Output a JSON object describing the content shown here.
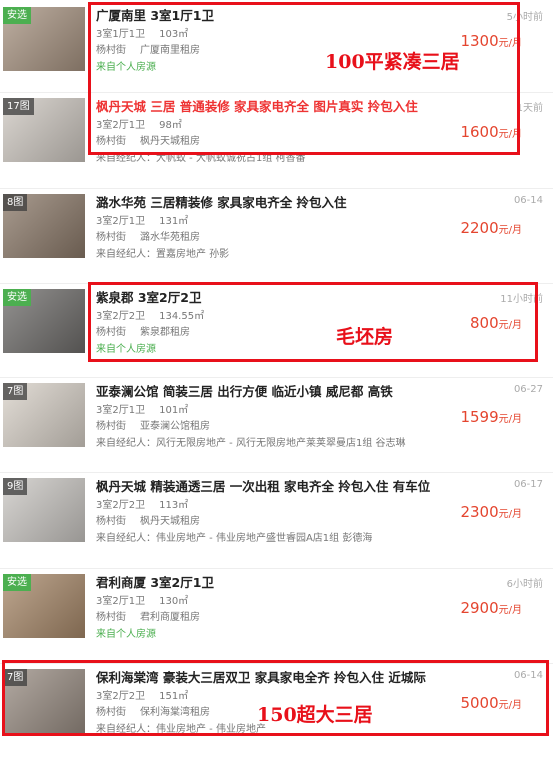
{
  "listings": [
    {
      "badge": "安选",
      "badge_type": "green",
      "title": "广厦南里 3室1厅1卫",
      "title_red": false,
      "layout": "3室1厅1卫",
      "area": "103㎡",
      "location": "杨村街",
      "estate_link": "广厦南里租房",
      "source": "来自个人房源",
      "source_type": "personal",
      "time": "5小时前",
      "price": "1300",
      "unit": "元/月",
      "thumb": "#a89482"
    },
    {
      "badge": "17图",
      "badge_type": "gray",
      "title": "枫丹天城 三居 普通装修 家具家电齐全 图片真实 拎包入住",
      "title_red": true,
      "layout": "3室2厅1卫",
      "area": "98㎡",
      "location": "杨村街",
      "estate_link": "枫丹天城租房",
      "source": "来自经纪人：大帆蚁 - 大帆蚁诚祝占1组 柯香番",
      "source_type": "agent",
      "time": "1天前",
      "price": "1600",
      "unit": "元/月",
      "thumb": "#cfc9c2"
    },
    {
      "badge": "8图",
      "badge_type": "gray",
      "title": "潞水华苑 三居精装修 家具家电齐全 拎包入住",
      "title_red": false,
      "layout": "3室2厅1卫",
      "area": "131㎡",
      "location": "杨村街",
      "estate_link": "潞水华苑租房",
      "source": "来自经纪人：置嘉房地产 孙影",
      "source_type": "agent",
      "time": "06-14",
      "price": "2200",
      "unit": "元/月",
      "thumb": "#8c7a6a"
    },
    {
      "badge": "安选",
      "badge_type": "green",
      "title": "紫泉郡 3室2厅2卫",
      "title_red": false,
      "layout": "3室2厅2卫",
      "area": "134.55㎡",
      "location": "杨村街",
      "estate_link": "紫泉郡租房",
      "source": "来自个人房源",
      "source_type": "personal",
      "time": "11小时前",
      "price": "800",
      "unit": "元/月",
      "thumb": "#6f6d6b"
    },
    {
      "badge": "7图",
      "badge_type": "gray",
      "title": "亚泰澜公馆 简装三居 出行方便 临近小镇 威尼都 高铁",
      "title_red": false,
      "layout": "3室2厅1卫",
      "area": "101㎡",
      "location": "杨村街",
      "estate_link": "亚泰澜公馆租房",
      "source": "来自经纪人：风行无限房地产 - 风行无限房地产莱荚翠曼店1组 谷志琳",
      "source_type": "agent",
      "time": "06-27",
      "price": "1599",
      "unit": "元/月",
      "thumb": "#d9d2c9"
    },
    {
      "badge": "9图",
      "badge_type": "gray",
      "title": "枫丹天城 精装通透三居 一次出租 家电齐全 拎包入住 有车位",
      "title_red": false,
      "layout": "3室2厅2卫",
      "area": "113㎡",
      "location": "杨村街",
      "estate_link": "枫丹天城租房",
      "source": "来自经纪人：伟业房地产 - 伟业房地产盛世睿园A店1组 彭德海",
      "source_type": "agent",
      "time": "06-17",
      "price": "2300",
      "unit": "元/月",
      "thumb": "#cbc8c4"
    },
    {
      "badge": "安选",
      "badge_type": "green",
      "title": "君利商厦 3室2厅1卫",
      "title_red": false,
      "layout": "3室2厅1卫",
      "area": "130㎡",
      "location": "杨村街",
      "estate_link": "君利商厦租房",
      "source": "来自个人房源",
      "source_type": "personal",
      "time": "6小时前",
      "price": "2900",
      "unit": "元/月",
      "thumb": "#a8896a"
    },
    {
      "badge": "7图",
      "badge_type": "gray",
      "title": "保利海棠湾 豪装大三居双卫 家具家电全齐 拎包入住 近城际",
      "title_red": false,
      "layout": "3室2厅2卫",
      "area": "151㎡",
      "location": "杨村街",
      "estate_link": "保利海棠湾租房",
      "source": "来自经纪人：伟业房地产 - 伟业房地产",
      "source_type": "agent",
      "time": "06-14",
      "price": "5000",
      "unit": "元/月",
      "thumb": "#9a8e84"
    }
  ],
  "annotations": {
    "a1": "100平紧凑三居",
    "a2": "毛坯房",
    "a3": "150超大三居"
  },
  "colors": {
    "annotation_red": "#e8101a",
    "price_red": "#e4452f",
    "personal_green": "#4caf50"
  }
}
